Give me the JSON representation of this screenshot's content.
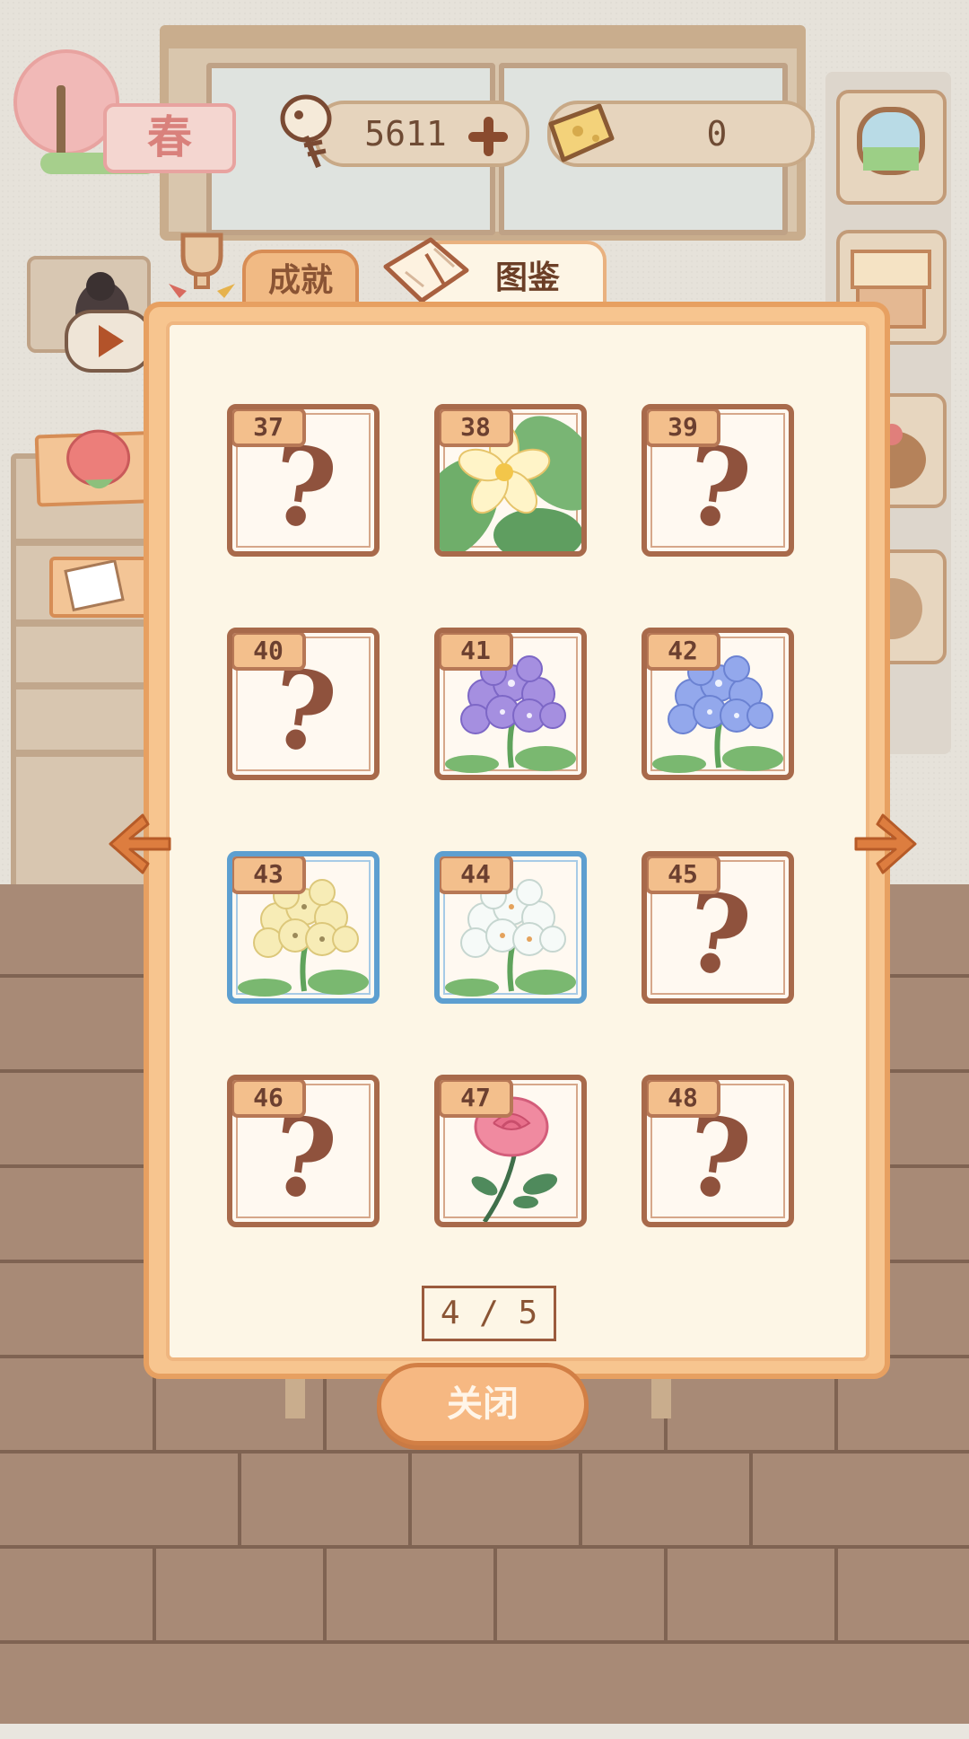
{
  "hud": {
    "season": "春",
    "fish_count": "5611",
    "cheese_count": "0"
  },
  "tabs": {
    "achievements": "成就",
    "album": "图鉴"
  },
  "album": {
    "cards": [
      {
        "number": "37",
        "state": "locked",
        "icon": "question-mark-icon"
      },
      {
        "number": "38",
        "state": "unlocked",
        "icon": "yellow-frangipani-flower-icon"
      },
      {
        "number": "39",
        "state": "locked",
        "icon": "question-mark-icon"
      },
      {
        "number": "40",
        "state": "locked",
        "icon": "question-mark-icon"
      },
      {
        "number": "41",
        "state": "unlocked",
        "icon": "purple-hydrangea-flower-icon"
      },
      {
        "number": "42",
        "state": "unlocked",
        "icon": "blue-hydrangea-flower-icon"
      },
      {
        "number": "43",
        "state": "unlocked-rare",
        "icon": "yellow-hydrangea-flower-icon"
      },
      {
        "number": "44",
        "state": "unlocked-rare",
        "icon": "white-hydrangea-flower-icon"
      },
      {
        "number": "45",
        "state": "locked",
        "icon": "question-mark-icon"
      },
      {
        "number": "46",
        "state": "locked",
        "icon": "question-mark-icon"
      },
      {
        "number": "47",
        "state": "unlocked",
        "icon": "pink-rose-flower-icon"
      },
      {
        "number": "48",
        "state": "locked",
        "icon": "question-mark-icon"
      }
    ],
    "locked_symbol": "?",
    "page_indicator": "4 / 5",
    "close_label": "关闭"
  },
  "colors": {
    "panel_orange": "#f7c58f",
    "panel_inner": "#fdf6e6",
    "card_border": "#a86a4b",
    "rare_border": "#5d9fd0",
    "arrow": "#d9773b"
  }
}
